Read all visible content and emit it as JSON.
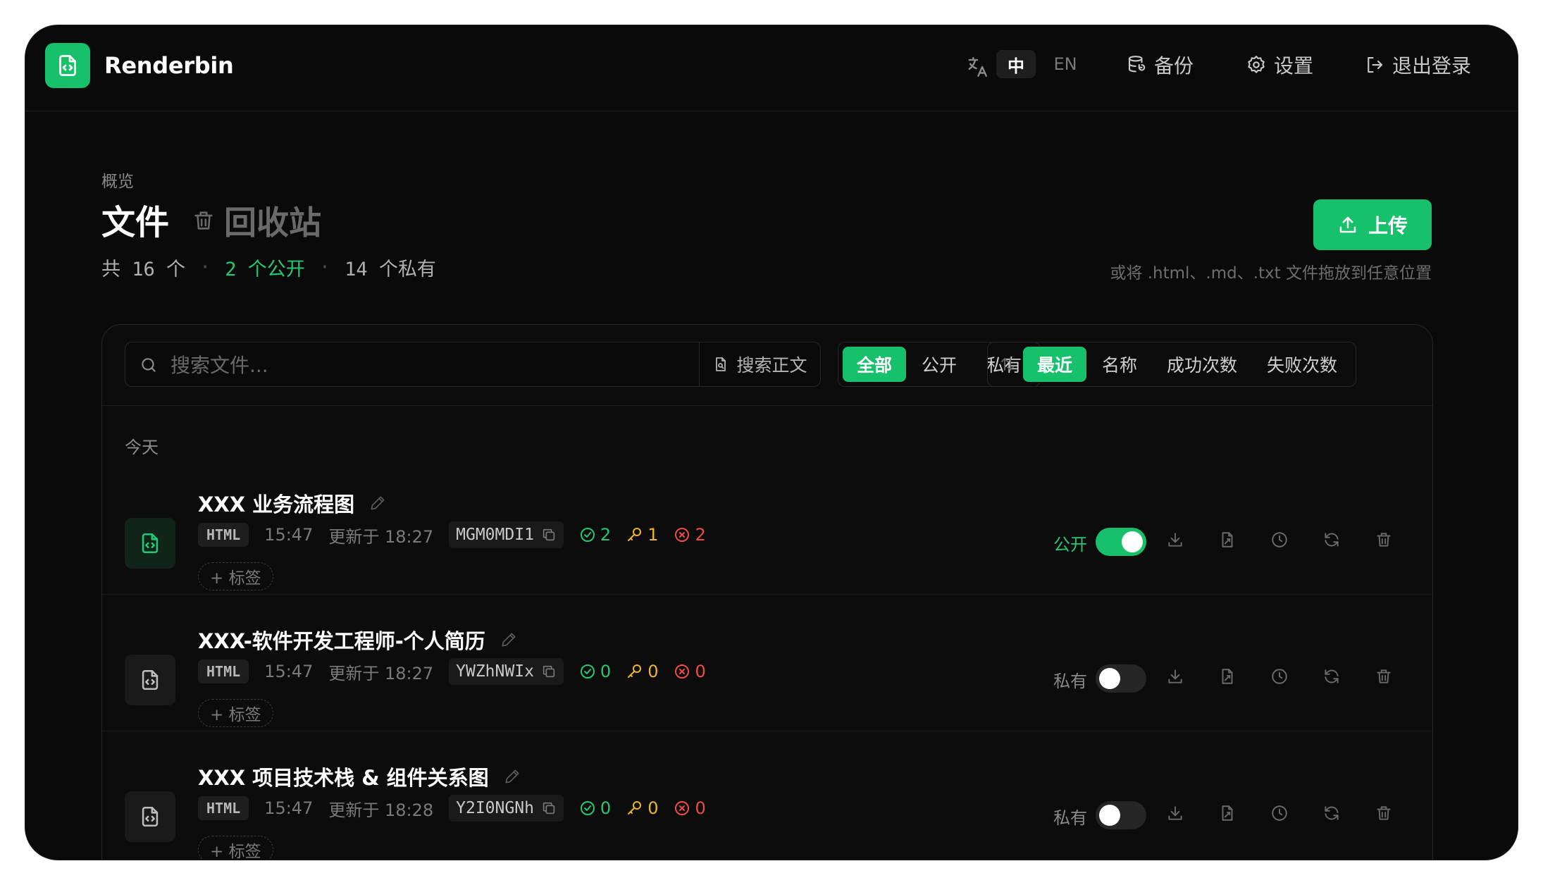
{
  "app": {
    "brand": "Renderbin"
  },
  "header": {
    "lang_zh": "中",
    "lang_en": "EN",
    "backup_label": "备份",
    "settings_label": "设置",
    "logout_label": "退出登录"
  },
  "page": {
    "breadcrumb": "概览",
    "title": "文件",
    "trash_label": "回收站",
    "stats": {
      "total": "共 16 个",
      "public": "2 个公开",
      "private": "14 个私有"
    },
    "upload_label": "上传",
    "upload_hint": "或将 .html、.md、.txt 文件拖放到任意位置"
  },
  "toolbar": {
    "search_placeholder": "搜索文件...",
    "fulltext_label": "搜索正文",
    "filters": [
      "全部",
      "公开",
      "私有"
    ],
    "active_filter": "全部",
    "sorts": [
      "最近",
      "名称",
      "成功次数",
      "失败次数"
    ],
    "active_sort": "最近"
  },
  "group_label": "今天",
  "files": [
    {
      "name": "XXX 业务流程图",
      "type": "HTML",
      "created": "15:47",
      "updated": "更新于 18:27",
      "code": "MGM0MDI1",
      "success": "2",
      "keys": "1",
      "failures": "2",
      "tag_label": "+ 标签",
      "visibility": "公开",
      "is_public": true
    },
    {
      "name": "XXX-软件开发工程师-个人简历",
      "type": "HTML",
      "created": "15:47",
      "updated": "更新于 18:27",
      "code": "YWZhNWIx",
      "success": "0",
      "keys": "0",
      "failures": "0",
      "tag_label": "+ 标签",
      "visibility": "私有",
      "is_public": false
    },
    {
      "name": "XXX 项目技术栈 & 组件关系图",
      "type": "HTML",
      "created": "15:47",
      "updated": "更新于 18:28",
      "code": "Y2I0NGNh",
      "success": "0",
      "keys": "0",
      "failures": "0",
      "tag_label": "+ 标签",
      "visibility": "私有",
      "is_public": false
    }
  ],
  "colors": {
    "accent": "#17c06a",
    "success": "#22c874",
    "warning": "#f0b429",
    "danger": "#ef4b4b",
    "background": "#0a0a0a"
  },
  "icons": [
    "file-code-icon",
    "translate-icon",
    "database-icon",
    "gear-icon",
    "logout-icon",
    "trash-icon",
    "upload-icon",
    "search-icon",
    "file-search-icon",
    "sort-icon",
    "pencil-icon",
    "copy-icon",
    "check-circle-icon",
    "key-icon",
    "x-circle-icon",
    "download-icon",
    "file-preview-icon",
    "history-icon",
    "refresh-icon"
  ]
}
